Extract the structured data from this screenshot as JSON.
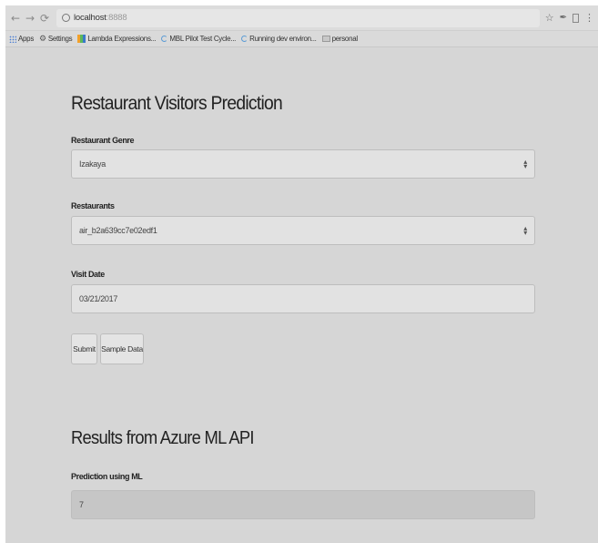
{
  "browser": {
    "url_host": "localhost",
    "url_port": ":8888",
    "bookmarks": [
      {
        "label": "Apps",
        "icon": "apps-icon"
      },
      {
        "label": "Settings",
        "icon": "gear-icon"
      },
      {
        "label": "Lambda Expressions...",
        "icon": "lambda-icon"
      },
      {
        "label": "MBL Pilot Test Cycle...",
        "icon": "spinner-icon"
      },
      {
        "label": "Running dev environ...",
        "icon": "spinner-icon"
      },
      {
        "label": "personal",
        "icon": "folder-icon"
      }
    ]
  },
  "page": {
    "title": "Restaurant Visitors Prediction",
    "genre": {
      "label": "Restaurant Genre",
      "value": "Izakaya"
    },
    "restaurants": {
      "label": "Restaurants",
      "value": "air_b2a639cc7e02edf1"
    },
    "visit_date": {
      "label": "Visit Date",
      "value": "03/21/2017"
    },
    "buttons": {
      "submit": "Submit",
      "sample": "Sample Data"
    },
    "results": {
      "title": "Results from Azure ML API",
      "label": "Prediction using ML",
      "value": "7"
    }
  }
}
